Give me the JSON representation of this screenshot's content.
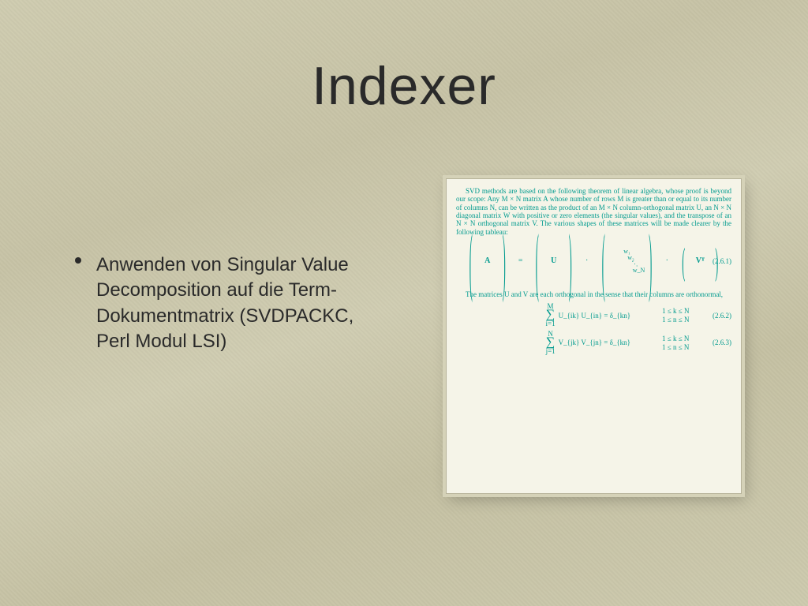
{
  "title": "Indexer",
  "bullet": {
    "text": "Anwenden von Singular Value Decomposition auf die Term-Dokumentmatrix (SVDPACKC, Perl Modul LSI)"
  },
  "panel": {
    "intro": "SVD methods are based on the following theorem of linear algebra, whose proof is beyond our scope: Any M × N matrix A whose number of rows M is greater than or equal to its number of columns N, can be written as the product of an M × N column-orthogonal matrix U, an N × N diagonal matrix W with positive or zero elements (the singular values), and the transpose of an N × N orthogonal matrix V. The various shapes of these matrices will be made clearer by the following tableau:",
    "eq_main": {
      "A": "A",
      "eq": "=",
      "U": "U",
      "dot1": "·",
      "W_diag": [
        "w₁",
        "w₂",
        "⋱",
        "w_N"
      ],
      "dot2": "·",
      "VT": "Vᵀ",
      "tag": "(2.6.1)"
    },
    "mid_text": "The matrices U and V are each orthogonal in the sense that their columns are orthonormal,",
    "eq2": {
      "sum_top": "M",
      "sum_bot": "i=1",
      "body": "U_{ik} U_{in} = δ_{kn}",
      "cond1": "1 ≤ k ≤ N",
      "cond2": "1 ≤ n ≤ N",
      "tag": "(2.6.2)"
    },
    "eq3": {
      "sum_top": "N",
      "sum_bot": "j=1",
      "body": "V_{jk} V_{jn} = δ_{kn}",
      "cond1": "1 ≤ k ≤ N",
      "cond2": "1 ≤ n ≤ N",
      "tag": "(2.6.3)"
    }
  }
}
